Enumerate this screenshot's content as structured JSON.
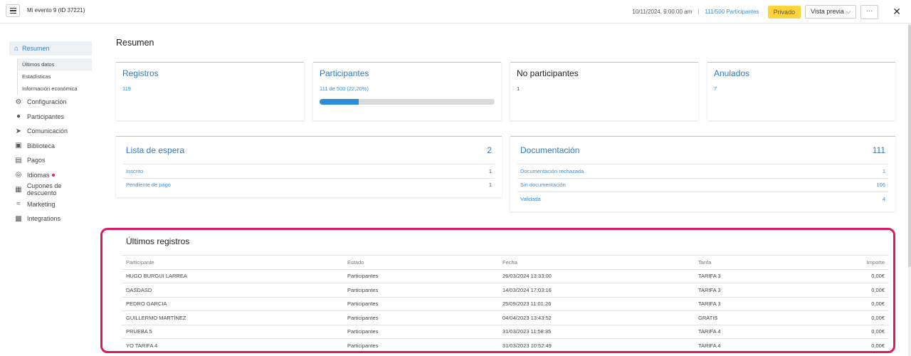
{
  "topbar": {
    "event_title": "Mi evento 9 (ID 37221)",
    "date": "10/11/2024, 9:00:00 am",
    "separator": "|",
    "participants": "111/500 Participantes",
    "private_label": "Privado",
    "preview_label": "Vista previa ⌵",
    "more_label": "···",
    "close_label": "✕"
  },
  "sidebar": {
    "active": "Resumen",
    "subitems": [
      "Últimos datos",
      "Estadísticas",
      "Información económica"
    ],
    "items": [
      {
        "label": "Configuración",
        "icon": "gear-icon"
      },
      {
        "label": "Participantes",
        "icon": "user-icon"
      },
      {
        "label": "Comunicación",
        "icon": "send-icon"
      },
      {
        "label": "Biblioteca",
        "icon": "image-icon"
      },
      {
        "label": "Pagos",
        "icon": "card-icon"
      },
      {
        "label": "Idiomas",
        "icon": "globe-icon"
      },
      {
        "label": "Cupones de descuento",
        "icon": "ticket-icon"
      },
      {
        "label": "Marketing",
        "icon": "chart-icon"
      },
      {
        "label": "Integrations",
        "icon": "plugin-icon"
      }
    ]
  },
  "page_title": "Resumen",
  "stats": {
    "registros": {
      "title": "Registros",
      "value": "119"
    },
    "participantes": {
      "title": "Participantes",
      "value": "111 de 500 (22,20%)",
      "progress": 0.222
    },
    "no_participantes": {
      "title": "No participantes",
      "value": "1"
    },
    "anulados": {
      "title": "Anulados",
      "value": "7"
    }
  },
  "waitlist": {
    "title": "Lista de espera",
    "total": "2",
    "rows": [
      {
        "label": "Inscrito",
        "count": "1"
      },
      {
        "label": "Pendiente de pago",
        "count": "1"
      }
    ]
  },
  "documentation": {
    "title": "Documentación",
    "total": "111",
    "rows": [
      {
        "label": "Documentación rechazada",
        "count": "1"
      },
      {
        "label": "Sin documentación",
        "count": "106"
      },
      {
        "label": "Validada",
        "count": "4"
      }
    ]
  },
  "registrations": {
    "title": "Últimos registros",
    "columns": [
      "Participante",
      "Estado",
      "Fecha",
      "Tarifa",
      "Importe"
    ],
    "rows": [
      [
        "HUGO BURGUI LARREA",
        "Participantes",
        "26/03/2024 13:33:00",
        "TARIFA 3",
        "0,00€"
      ],
      [
        "DASDASD",
        "Participantes",
        "14/03/2024 17:03:16",
        "TARIFA 3",
        "0,00€"
      ],
      [
        "PEDRO GARCIA",
        "Participantes",
        "25/09/2023 11:01:26",
        "TARIFA 3",
        "0,00€"
      ],
      [
        "GUILLERMO MARTÍNEZ",
        "Participantes",
        "04/04/2023 13:43:52",
        "GRATIS",
        "0,00€"
      ],
      [
        "PRUEBA 5",
        "Participantes",
        "31/03/2023 11:58:35",
        "TARIFA 4",
        "0,00€"
      ],
      [
        "YO TARIFA 4",
        "Participantes",
        "31/03/2023 10:52:49",
        "TARIFA 4",
        "0,00€"
      ]
    ]
  },
  "colors": {
    "accent": "#2e7ac4",
    "private": "#ffd43b",
    "highlight": "#d81b60"
  }
}
